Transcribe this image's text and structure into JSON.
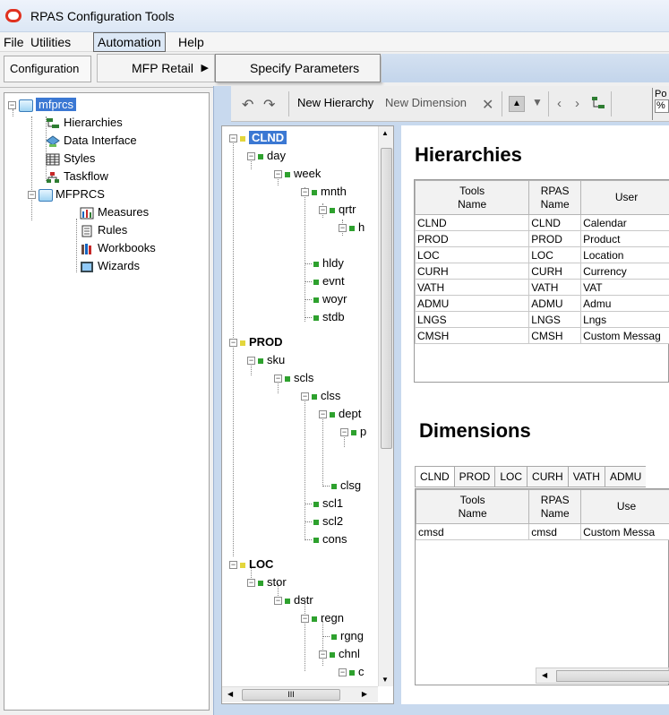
{
  "window": {
    "title": "RPAS Configuration Tools"
  },
  "menubar": {
    "items": [
      "File",
      "Utilities",
      "Automation",
      "Help"
    ]
  },
  "config_tab": "Configuration",
  "submenu": {
    "level1": "MFP Retail",
    "level2": "Specify Parameters"
  },
  "left_tree": {
    "root": "mfprcs",
    "children": [
      "Hierarchies",
      "Data Interface",
      "Styles",
      "Taskflow"
    ],
    "project": "MFPRCS",
    "project_children": [
      "Measures",
      "Rules",
      "Workbooks",
      "Wizards"
    ]
  },
  "toolbar": {
    "new_hierarchy": "New Hierarchy",
    "new_dimension": "New Dimension",
    "pos_label": "Po",
    "pos_value": "%"
  },
  "mid_tree": {
    "clnd": "CLND",
    "day": "day",
    "week": "week",
    "mnth": "mnth",
    "qrtr": "qrtr",
    "h_trunc": "h",
    "hldy": "hldy",
    "evnt": "evnt",
    "woyr": "woyr",
    "stdb": "stdb",
    "prod": "PROD",
    "sku": "sku",
    "scls": "scls",
    "clss": "clss",
    "dept": "dept",
    "p_trunc": "p",
    "clsg": "clsg",
    "scl1": "scl1",
    "scl2": "scl2",
    "cons": "cons",
    "loc": "LOC",
    "stor": "stor",
    "dstr": "dstr",
    "regn": "regn",
    "rgng": "rgng",
    "chnl": "chnl",
    "c_trunc": "c",
    "hscroll_glyph": "III"
  },
  "hierarchies": {
    "heading": "Hierarchies",
    "headers": {
      "tools": "Tools\nName",
      "rpas": "RPAS\nName",
      "user": "User"
    },
    "rows": [
      [
        "CLND",
        "CLND",
        "Calendar"
      ],
      [
        "PROD",
        "PROD",
        "Product"
      ],
      [
        "LOC",
        "LOC",
        "Location"
      ],
      [
        "CURH",
        "CURH",
        "Currency"
      ],
      [
        "VATH",
        "VATH",
        "VAT"
      ],
      [
        "ADMU",
        "ADMU",
        "Admu"
      ],
      [
        "LNGS",
        "LNGS",
        "Lngs"
      ],
      [
        "CMSH",
        "CMSH",
        "Custom Messag"
      ]
    ]
  },
  "dimensions": {
    "heading": "Dimensions",
    "tabs": [
      "CLND",
      "PROD",
      "LOC",
      "CURH",
      "VATH",
      "ADMU"
    ],
    "headers": {
      "tools": "Tools\nName",
      "rpas": "RPAS\nName",
      "user": "Use"
    },
    "rows": [
      [
        "cmsd",
        "cmsd",
        "Custom Messa"
      ]
    ]
  }
}
